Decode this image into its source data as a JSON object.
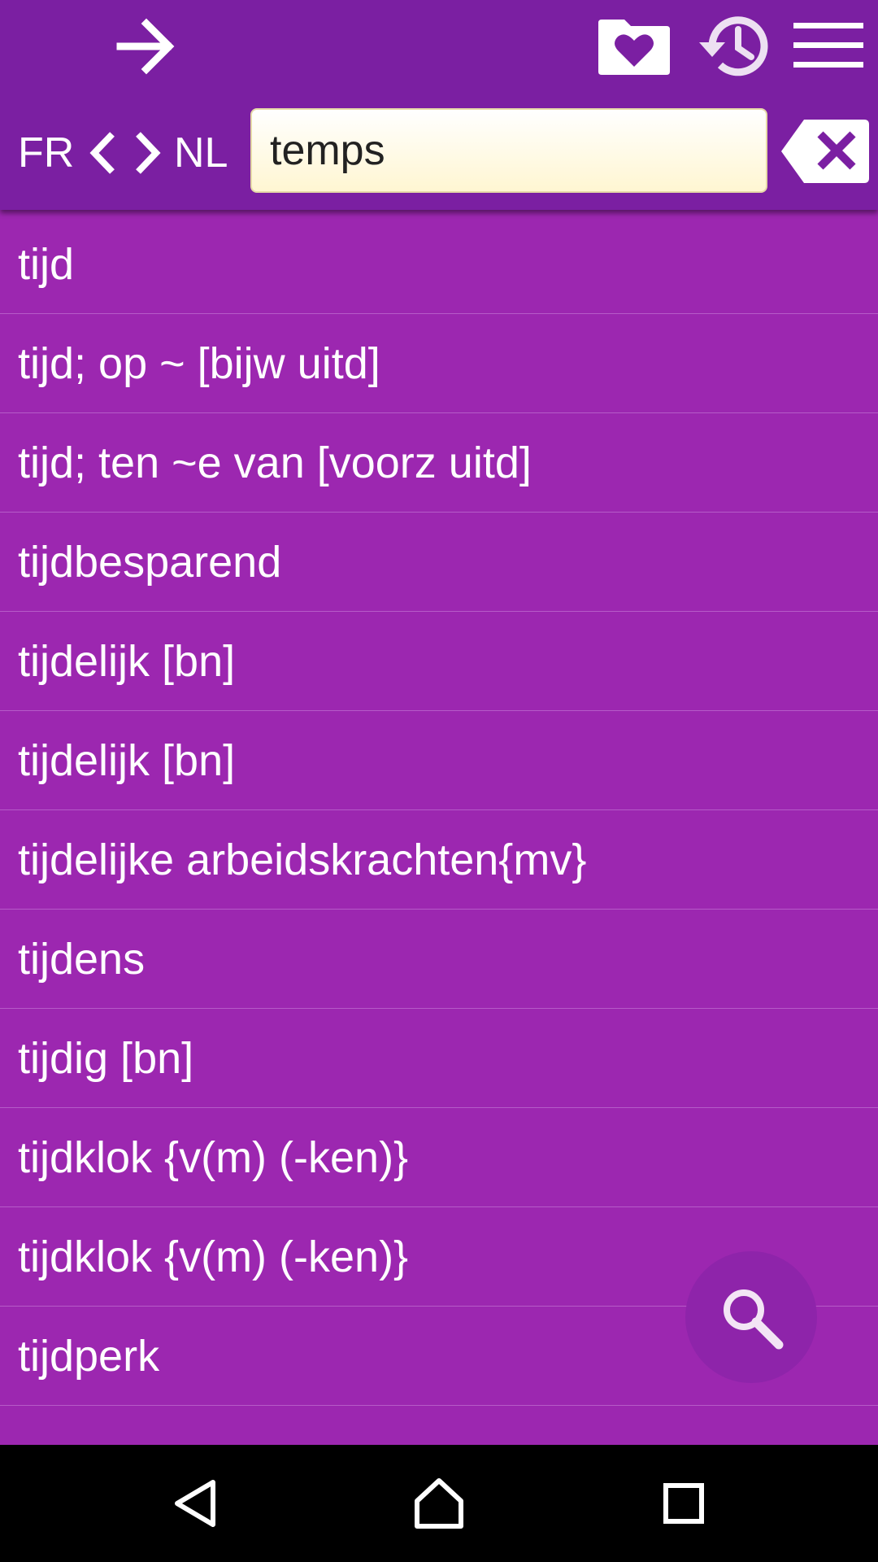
{
  "header": {
    "icons": {
      "forward": "arrow-right-icon",
      "favorites": "heart-folder-icon",
      "history": "history-clock-icon",
      "menu": "hamburger-menu-icon",
      "clear": "backspace-clear-icon"
    }
  },
  "language": {
    "from": "FR",
    "to": "NL"
  },
  "search": {
    "query": "temps"
  },
  "results": [
    "tijd",
    "tijd; op ~ [bijw uitd]",
    "tijd; ten ~e van [voorz uitd]",
    "tijdbesparend",
    "tijdelijk [bn]",
    "tijdelijk [bn]",
    "tijdelijke arbeidskrachten{mv}",
    "tijdens",
    "tijdig [bn]",
    "tijdklok {v(m) (-ken)}",
    "tijdklok {v(m) (-ken)}",
    "tijdperk"
  ],
  "colors": {
    "app_bar": "#7B1FA2",
    "list_background": "#9C27B0",
    "divider": "#B65BC8",
    "fab": "#8E24AA",
    "nav_bar": "#000000"
  }
}
